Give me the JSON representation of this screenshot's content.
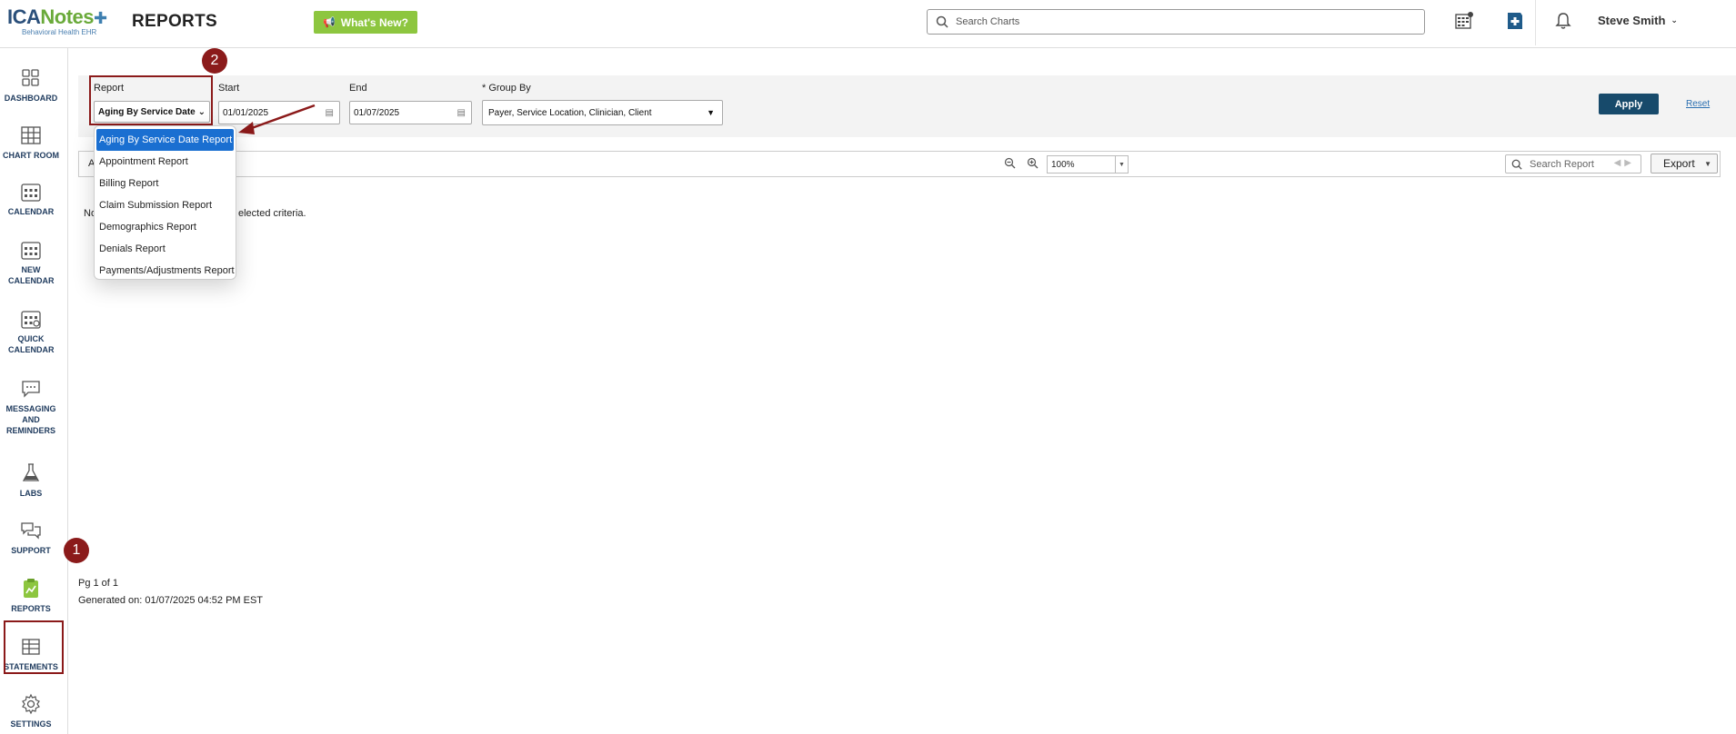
{
  "header": {
    "logo_brand_ica": "ICA",
    "logo_brand_notes": "Notes",
    "logo_subtitle": "Behavioral Health EHR",
    "page_title": "REPORTS",
    "whats_new_label": "What's New?",
    "search_placeholder": "Search Charts",
    "user_name": "Steve Smith",
    "icons": [
      "calendar-grid-icon",
      "add-chart-icon",
      "bell-icon"
    ]
  },
  "sidebar": {
    "items": [
      {
        "label": "DASHBOARD",
        "icon": "dashboard-icon"
      },
      {
        "label": "CHART ROOM",
        "icon": "chart-room-icon"
      },
      {
        "label": "CALENDAR",
        "icon": "calendar-icon"
      },
      {
        "label": "NEW CALENDAR",
        "icon": "new-calendar-icon"
      },
      {
        "label": "QUICK CALENDAR",
        "icon": "quick-calendar-icon"
      },
      {
        "label": "MESSAGING AND REMINDERS",
        "icon": "messaging-icon"
      },
      {
        "label": "LABS",
        "icon": "flask-icon"
      },
      {
        "label": "SUPPORT",
        "icon": "support-icon"
      },
      {
        "label": "REPORTS",
        "icon": "reports-icon"
      },
      {
        "label": "STATEMENTS",
        "icon": "statements-icon"
      },
      {
        "label": "SETTINGS",
        "icon": "gear-icon"
      }
    ]
  },
  "filters": {
    "report_label": "Report",
    "report_value": "Aging By Service Date",
    "start_label": "Start",
    "start_value": "01/01/2025",
    "end_label": "End",
    "end_value": "01/07/2025",
    "group_by_label": "* Group By",
    "group_by_value": "Payer, Service Location, Clinician, Client",
    "apply_label": "Apply",
    "reset_label": "Reset"
  },
  "report_dropdown": {
    "options": [
      "Aging By Service Date Report",
      "Appointment Report",
      "Billing Report",
      "Claim Submission Report",
      "Demographics Report",
      "Denials Report",
      "Payments/Adjustments Report"
    ],
    "selected_index": 0
  },
  "toolbar": {
    "left_text": "A",
    "zoom_value": "100%",
    "search_placeholder": "Search Report",
    "export_label": "Export"
  },
  "report_body": {
    "message_start": "No",
    "message_end": "elected criteria."
  },
  "footer": {
    "page": "Pg 1 of 1",
    "generated": "Generated on: 01/07/2025 04:52 PM EST"
  },
  "annotations": {
    "badge_1": "1",
    "badge_2": "2"
  },
  "colors": {
    "accent_dark": "#174a6b",
    "highlight_red": "#8b1a1a",
    "whats_new_green": "#8dc63f",
    "selected_blue": "#1a6fd1"
  }
}
